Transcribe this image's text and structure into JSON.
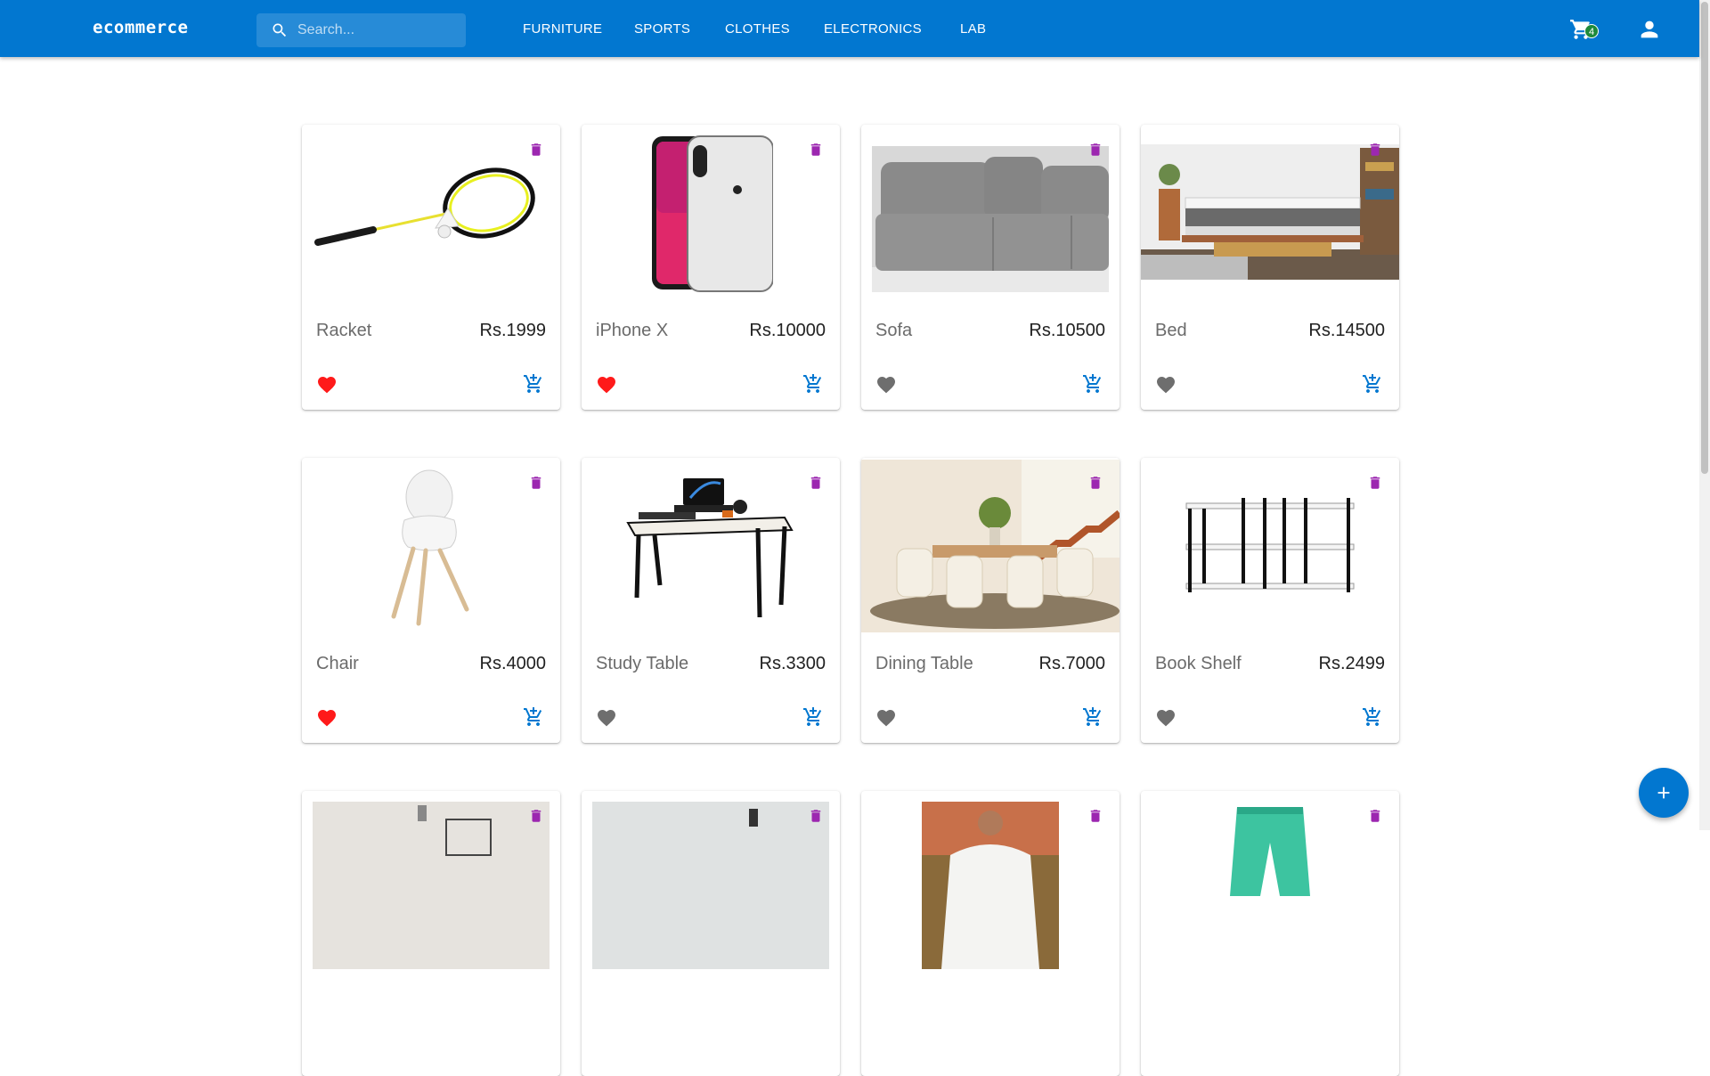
{
  "app": {
    "brand": "ecommerce"
  },
  "search": {
    "placeholder": "Search..."
  },
  "nav": [
    {
      "label": "FURNITURE"
    },
    {
      "label": "SPORTS"
    },
    {
      "label": "CLOTHES"
    },
    {
      "label": "ELECTRONICS"
    },
    {
      "label": "LAB"
    }
  ],
  "cart": {
    "count": "4"
  },
  "colors": {
    "primary": "#0277d0",
    "favorite_active": "#ff1a1a",
    "favorite_inactive": "#6e6e6e",
    "delete": "#9c27b0",
    "cart_badge": "#1e8a3a"
  },
  "products": [
    {
      "name": "Racket",
      "price": "Rs.1999",
      "favorite": true,
      "image": "racket"
    },
    {
      "name": "iPhone X",
      "price": "Rs.10000",
      "favorite": true,
      "image": "phone"
    },
    {
      "name": "Sofa",
      "price": "Rs.10500",
      "favorite": false,
      "image": "sofa"
    },
    {
      "name": "Bed",
      "price": "Rs.14500",
      "favorite": false,
      "image": "bed"
    },
    {
      "name": "Chair",
      "price": "Rs.4000",
      "favorite": true,
      "image": "chair"
    },
    {
      "name": "Study Table",
      "price": "Rs.3300",
      "favorite": false,
      "image": "desk"
    },
    {
      "name": "Dining Table",
      "price": "Rs.7000",
      "favorite": false,
      "image": "dining"
    },
    {
      "name": "Book Shelf",
      "price": "Rs.2499",
      "favorite": false,
      "image": "shelf"
    },
    {
      "name": "",
      "price": "",
      "favorite": false,
      "image": "room"
    },
    {
      "name": "",
      "price": "",
      "favorite": false,
      "image": "room2"
    },
    {
      "name": "",
      "price": "",
      "favorite": false,
      "image": "shirt"
    },
    {
      "name": "",
      "price": "",
      "favorite": false,
      "image": "shorts"
    }
  ],
  "icons": {
    "search": "search-icon",
    "cart": "shopping-cart-icon",
    "user": "account-icon",
    "delete": "trash-icon",
    "favorite": "heart-icon",
    "add_to_cart": "add-shopping-cart-icon",
    "add": "plus-icon"
  }
}
